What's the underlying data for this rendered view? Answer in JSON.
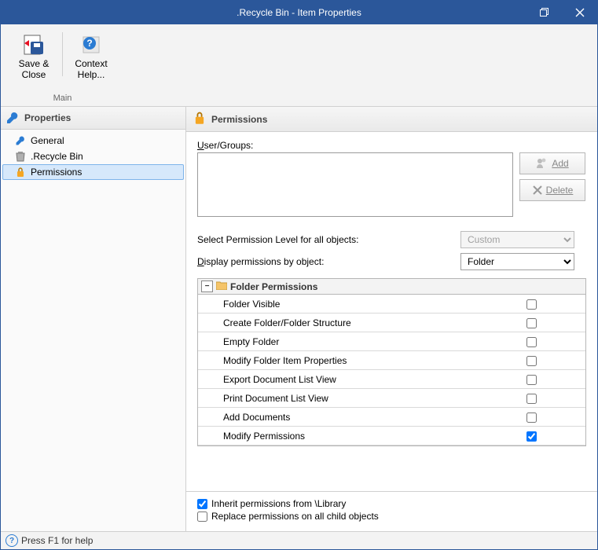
{
  "title": ".Recycle Bin - Item Properties",
  "ribbon": {
    "group_label": "Main",
    "save_close": "Save & Close",
    "context_help": "Context Help..."
  },
  "nav": {
    "header": "Properties",
    "items": [
      {
        "label": "General"
      },
      {
        "label": ".Recycle Bin"
      },
      {
        "label": "Permissions"
      }
    ]
  },
  "panel": {
    "header": "Permissions",
    "user_groups_label": "User/Groups:",
    "add_btn": "Add",
    "delete_btn": "Delete",
    "select_level_label": "Select Permission Level for all objects:",
    "select_level_value": "Custom",
    "display_by_label": "Display permissions by object:",
    "display_by_value": "Folder",
    "group_header": "Folder Permissions",
    "rows": [
      {
        "name": "Folder Visible",
        "checked": false
      },
      {
        "name": "Create Folder/Folder Structure",
        "checked": false
      },
      {
        "name": "Empty Folder",
        "checked": false
      },
      {
        "name": "Modify Folder Item Properties",
        "checked": false
      },
      {
        "name": "Export Document List View",
        "checked": false
      },
      {
        "name": "Print Document List View",
        "checked": false
      },
      {
        "name": "Add Documents",
        "checked": false
      },
      {
        "name": "Modify Permissions",
        "checked": true
      }
    ],
    "inherit_label": "Inherit permissions from  \\Library",
    "inherit_checked": true,
    "replace_label": "Replace permissions on all child objects",
    "replace_checked": false
  },
  "status": "Press F1 for help"
}
